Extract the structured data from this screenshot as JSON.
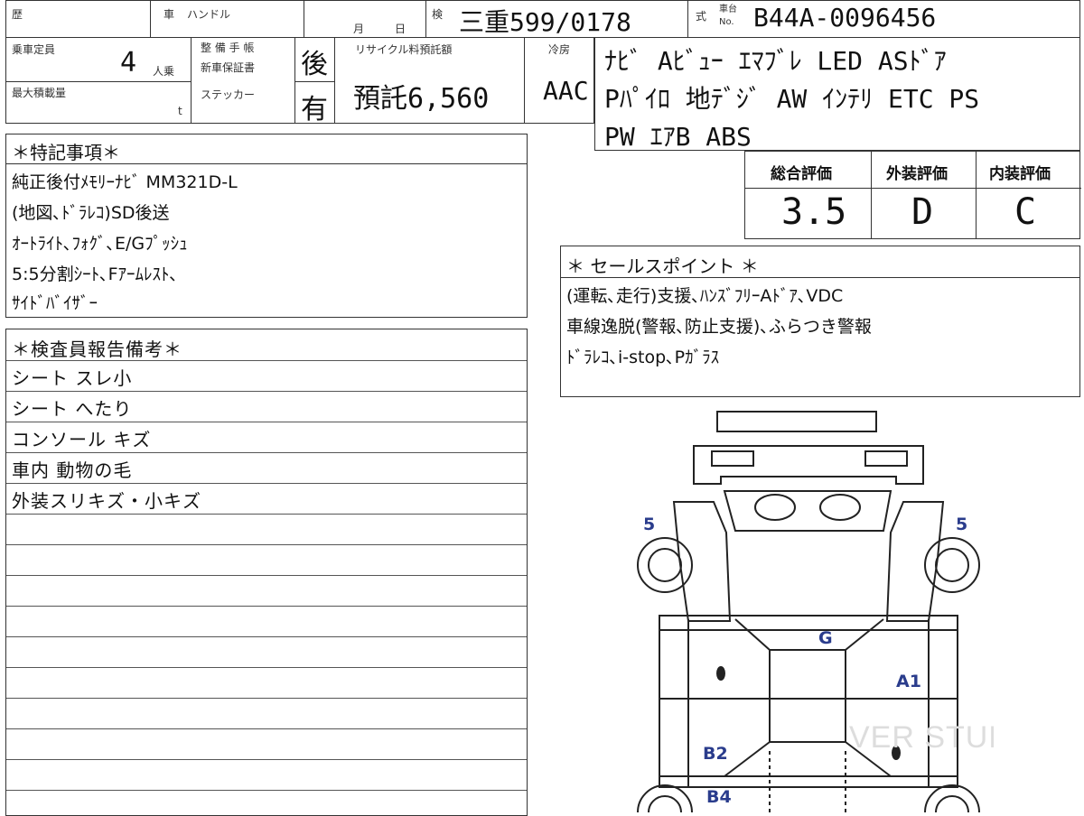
{
  "header": {
    "reki_label": "歴",
    "sha_label": "車",
    "handle_label": "ハンドル",
    "month_label": "月",
    "day_label": "日",
    "ken_label": "検",
    "plate": "三重599/0178",
    "shiki_label": "式",
    "chassis_label_top": "車台",
    "chassis_label_bottom": "No.",
    "chassis_number": "B44A-0096456"
  },
  "row2": {
    "capacity_label": "乗車定員",
    "capacity_value": "4",
    "capacity_unit": "人乗",
    "maxload_label": "最大積載量",
    "maxload_unit": "t",
    "seibi_label": "整 備 手 帳",
    "shinsha_label": "新車保証書",
    "sticker_label": "ステッカー",
    "seibi_value": "後",
    "sticker_value": "有",
    "recycle_label": "リサイクル料預託額",
    "recycle_value": "預託6,560",
    "reibo_label": "冷房",
    "reibo_value": "AAC"
  },
  "equipment": {
    "line1": "ﾅﾋﾞ Aﾋﾞｭｰ ｴﾏﾌﾞﾚ LED ASﾄﾞｱ",
    "line2": "Pﾊﾟｲﾛ 地ﾃﾞｼﾞ AW ｲﾝﾃﾘ ETC PS",
    "line3": "PW ｴｱB ABS"
  },
  "ratings": {
    "overall_label": "総合評価",
    "exterior_label": "外装評価",
    "interior_label": "内装評価",
    "overall_value": "3.5",
    "exterior_value": "D",
    "interior_value": "C"
  },
  "special": {
    "title": "＊特記事項＊",
    "lines": [
      "純正後付ﾒﾓﾘｰﾅﾋﾞ MM321D-L",
      "(地図､ﾄﾞﾗﾚｺ)SD後送",
      "ｵｰﾄﾗｲﾄ､ﾌｫｸﾞ､E/Gﾌﾟｯｼｭ",
      "5:5分割ｼｰﾄ､Fｱｰﾑﾚｽﾄ､",
      "ｻｲﾄﾞﾊﾞｲｻﾞｰ"
    ]
  },
  "sales": {
    "title": "＊ セールスポイント ＊",
    "lines": [
      "(運転､走行)支援､ﾊﾝｽﾞﾌﾘｰAﾄﾞｱ､VDC",
      "車線逸脱(警報､防止支援)､ふらつき警報",
      "ﾄﾞﾗﾚｺ､i-stop､Pｶﾞﾗｽ"
    ]
  },
  "inspector": {
    "title": "＊検査員報告備考＊",
    "lines": [
      "シート スレ小",
      "シート へたり",
      "コンソール キズ",
      "車内 動物の毛",
      "外装スリキズ・小キズ"
    ]
  },
  "diagram": {
    "label_left_front": "5",
    "label_right_front": "5",
    "label_g": "G",
    "label_a1": "A1",
    "label_b2": "B2",
    "label_b4": "B4",
    "watermark": "VER STUDIO PRO",
    "marks_color": "#2a3c8c"
  }
}
